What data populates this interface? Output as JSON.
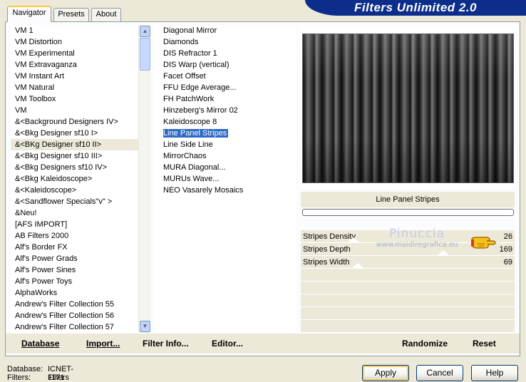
{
  "brand": "Filters Unlimited 2.0",
  "tabs": [
    "Navigator",
    "Presets",
    "About"
  ],
  "categories": [
    "VM 1",
    "VM Distortion",
    "VM Experimental",
    "VM Extravaganza",
    "VM Instant Art",
    "VM Natural",
    "VM Toolbox",
    "VM",
    "&<Background Designers IV>",
    "&<Bkg Designer sf10 I>",
    "&<BKg Designer sf10 II>",
    "&<Bkg Designer sf10 III>",
    "&<Bkg Designers sf10 IV>",
    "&<Bkg Kaleidoscope>",
    "&<Kaleidoscope>",
    "&<Sandflower Specials\"v\" >",
    "&Neu!",
    "[AFS IMPORT]",
    "AB Filters 2000",
    "Alf's Border FX",
    "Alf's Power Grads",
    "Alf's Power Sines",
    "Alf's Power Toys",
    "AlphaWorks",
    "Andrew's Filter Collection 55",
    "Andrew's Filter Collection 56",
    "Andrew's Filter Collection 57"
  ],
  "selected_category": "&<BKg Designer sf10 II>",
  "filters": [
    "Diagonal Mirror",
    "Diamonds",
    "DIS Refractor 1",
    "DIS Warp (vertical)",
    "Facet Offset",
    "FFU Edge Average...",
    "FH PatchWork",
    "Hinzeberg's Mirror 02",
    "Kaleidoscope 8",
    "Line Panel Stripes",
    "Line Side Line",
    "MirrorChaos",
    "MURA Diagonal...",
    "MURUs Wave...",
    "NEO Vasarely Mosaics"
  ],
  "selected_filter": "Line Panel Stripes",
  "filter_name": "Line Panel Stripes",
  "parameters": [
    {
      "name": "Stripes Density",
      "value": "26"
    },
    {
      "name": "Stripes Depth",
      "value": "169"
    },
    {
      "name": "Stripes Width",
      "value": "69"
    }
  ],
  "watermark": {
    "line1": "Pinuccia",
    "line2": "www.maidiregrafica.eu"
  },
  "bottom_buttons": {
    "database": "Database",
    "import": "Import...",
    "filter_info": "Filter Info...",
    "editor": "Editor...",
    "randomize": "Randomize",
    "reset": "Reset"
  },
  "status": {
    "database_label": "Database:",
    "database_value": "ICNET-Filters",
    "filters_label": "Filters:",
    "filters_value": "1171"
  },
  "dialog_buttons": {
    "apply": "Apply",
    "cancel": "Cancel",
    "help": "Help"
  },
  "icons": {
    "scroll_up": "scroll-up-arrow-icon",
    "scroll_down": "scroll-down-arrow-icon",
    "pointer": "pointing-hand-icon"
  }
}
